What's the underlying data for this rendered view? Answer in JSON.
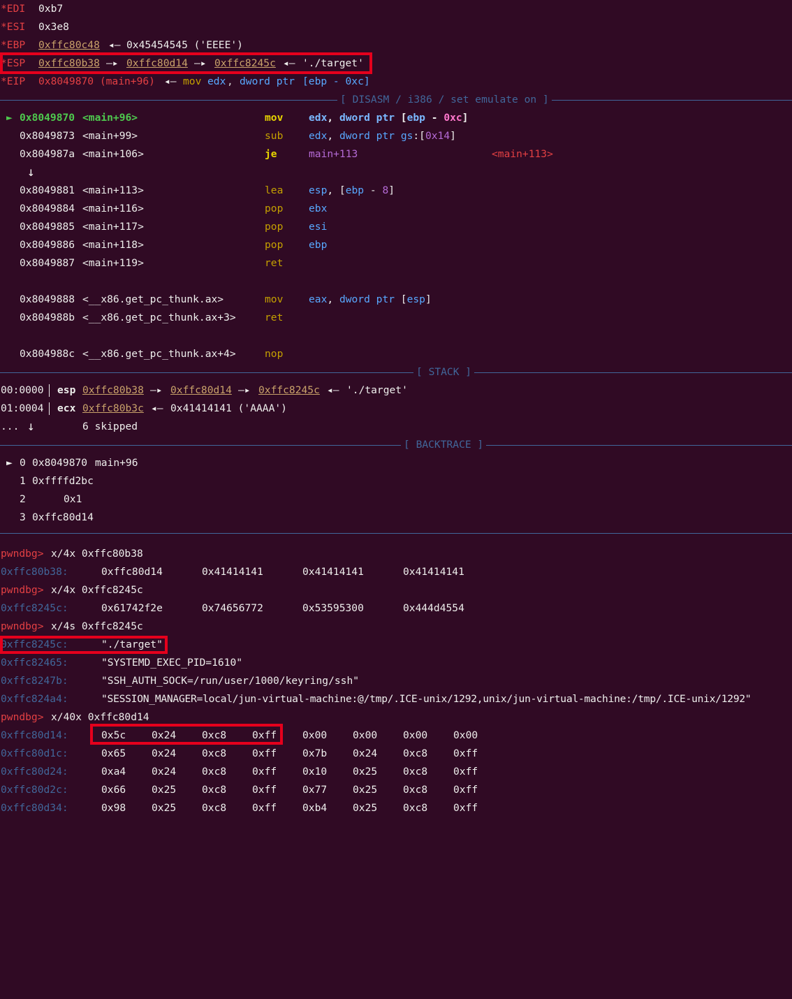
{
  "registers": [
    {
      "name": "*EDI",
      "value": "0xb7"
    },
    {
      "name": "*ESI",
      "value": "0x3e8"
    },
    {
      "name": "*EBP",
      "addr": "0xffc80c48",
      "arrow": "◂—",
      "rest": "0x45454545 ('EEEE')"
    },
    {
      "name": "*ESP",
      "a1": "0xffc80b38",
      "a2": "0xffc80d14",
      "a3": "0xffc8245c",
      "arrow": "—▸",
      "arrow2": "◂—",
      "rest": "'./target'"
    },
    {
      "name": "*EIP",
      "addr": "0x8049870 (main+96)",
      "arrow": "◂—",
      "mn": "mov",
      "op1": "edx",
      "op2": "dword ptr",
      "br": "[ebp - 0xc]"
    }
  ],
  "sections": {
    "disasm": "[ DISASM / i386 / set emulate on ]",
    "stack": "[ STACK ]",
    "backtrace": "[ BACKTRACE ]"
  },
  "disasm": [
    {
      "marker": "►",
      "addr": "0x8049870",
      "sym": "<main+96>",
      "mn": "mov",
      "ops": "edx, dword ptr [ebp - 0xc]"
    },
    {
      "addr": "0x8049873",
      "sym": "<main+99>",
      "mn": "sub",
      "ops": "edx, dword ptr gs:[0x14]"
    },
    {
      "addr": "0x804987a",
      "sym": "<main+106>",
      "mn": "je",
      "ops": "main+113",
      "target": "<main+113>"
    },
    {
      "arrow": "↓"
    },
    {
      "addr": "0x8049881",
      "sym": "<main+113>",
      "mn": "lea",
      "ops": "esp, [ebp - 8]"
    },
    {
      "addr": "0x8049884",
      "sym": "<main+116>",
      "mn": "pop",
      "ops": "ebx"
    },
    {
      "addr": "0x8049885",
      "sym": "<main+117>",
      "mn": "pop",
      "ops": "esi"
    },
    {
      "addr": "0x8049886",
      "sym": "<main+118>",
      "mn": "pop",
      "ops": "ebp"
    },
    {
      "addr": "0x8049887",
      "sym": "<main+119>",
      "mn": "ret",
      "ops": ""
    },
    {
      "addr": "0x8049888",
      "sym": "<__x86.get_pc_thunk.ax>",
      "mn": "mov",
      "ops": "eax, dword ptr [esp]"
    },
    {
      "addr": "0x804988b",
      "sym": "<__x86.get_pc_thunk.ax+3>",
      "mn": "ret",
      "ops": ""
    },
    {
      "addr": "0x804988c",
      "sym": "<__x86.get_pc_thunk.ax+4>",
      "mn": "nop",
      "ops": ""
    }
  ],
  "stack": [
    {
      "idx": "00:0000",
      "reg": "esp",
      "a1": "0xffc80b38",
      "a2": "0xffc80d14",
      "a3": "0xffc8245c",
      "arrow": "—▸",
      "arrow2": "◂—",
      "rest": "'./target'"
    },
    {
      "idx": "01:0004",
      "reg": "ecx",
      "a1": "0xffc80b3c",
      "arrow2": "◂—",
      "rest": "0x41414141 ('AAAA')"
    },
    {
      "idx": "...",
      "arrow": "↓",
      "rest": "6 skipped"
    }
  ],
  "backtrace": [
    {
      "marker": "►",
      "n": "0",
      "addr": "0x8049870",
      "sym": "main+96"
    },
    {
      "n": "1",
      "addr": "0xffffd2bc",
      "sym": ""
    },
    {
      "n": "2",
      "addr": "0x1",
      "sym": ""
    },
    {
      "n": "3",
      "addr": "0xffc80d14",
      "sym": ""
    }
  ],
  "prompt": "pwndbg>",
  "commands": [
    "x/4x 0xffc80b38",
    "x/4x 0xffc8245c",
    "x/4s 0xffc8245c",
    "x/40x 0xffc80d14"
  ],
  "words": [
    {
      "addr": "0xffc80b38:",
      "vals": [
        "0xffc80d14",
        "0x41414141",
        "0x41414141",
        "0x41414141"
      ]
    },
    {
      "addr": "0xffc8245c:",
      "vals": [
        "0x61742f2e",
        "0x74656772",
        "0x53595300",
        "0x444d4554"
      ]
    }
  ],
  "strings": [
    {
      "addr": "0xffc8245c:",
      "val": "\"./target\""
    },
    {
      "addr": "0xffc82465:",
      "val": "\"SYSTEMD_EXEC_PID=1610\""
    },
    {
      "addr": "0xffc8247b:",
      "val": "\"SSH_AUTH_SOCK=/run/user/1000/keyring/ssh\""
    },
    {
      "addr": "0xffc824a4:",
      "val": "\"SESSION_MANAGER=local/jun-virtual-machine:@/tmp/.ICE-unix/1292,unix/jun-virtual-machine:/tmp/.ICE-unix/1292\""
    }
  ],
  "bytes": [
    {
      "addr": "0xffc80d14:",
      "vals": [
        "0x5c",
        "0x24",
        "0xc8",
        "0xff",
        "0x00",
        "0x00",
        "0x00",
        "0x00"
      ]
    },
    {
      "addr": "0xffc80d1c:",
      "vals": [
        "0x65",
        "0x24",
        "0xc8",
        "0xff",
        "0x7b",
        "0x24",
        "0xc8",
        "0xff"
      ]
    },
    {
      "addr": "0xffc80d24:",
      "vals": [
        "0xa4",
        "0x24",
        "0xc8",
        "0xff",
        "0x10",
        "0x25",
        "0xc8",
        "0xff"
      ]
    },
    {
      "addr": "0xffc80d2c:",
      "vals": [
        "0x66",
        "0x25",
        "0xc8",
        "0xff",
        "0x77",
        "0x25",
        "0xc8",
        "0xff"
      ]
    },
    {
      "addr": "0xffc80d34:",
      "vals": [
        "0x98",
        "0x25",
        "0xc8",
        "0xff",
        "0xb4",
        "0x25",
        "0xc8",
        "0xff"
      ]
    }
  ]
}
